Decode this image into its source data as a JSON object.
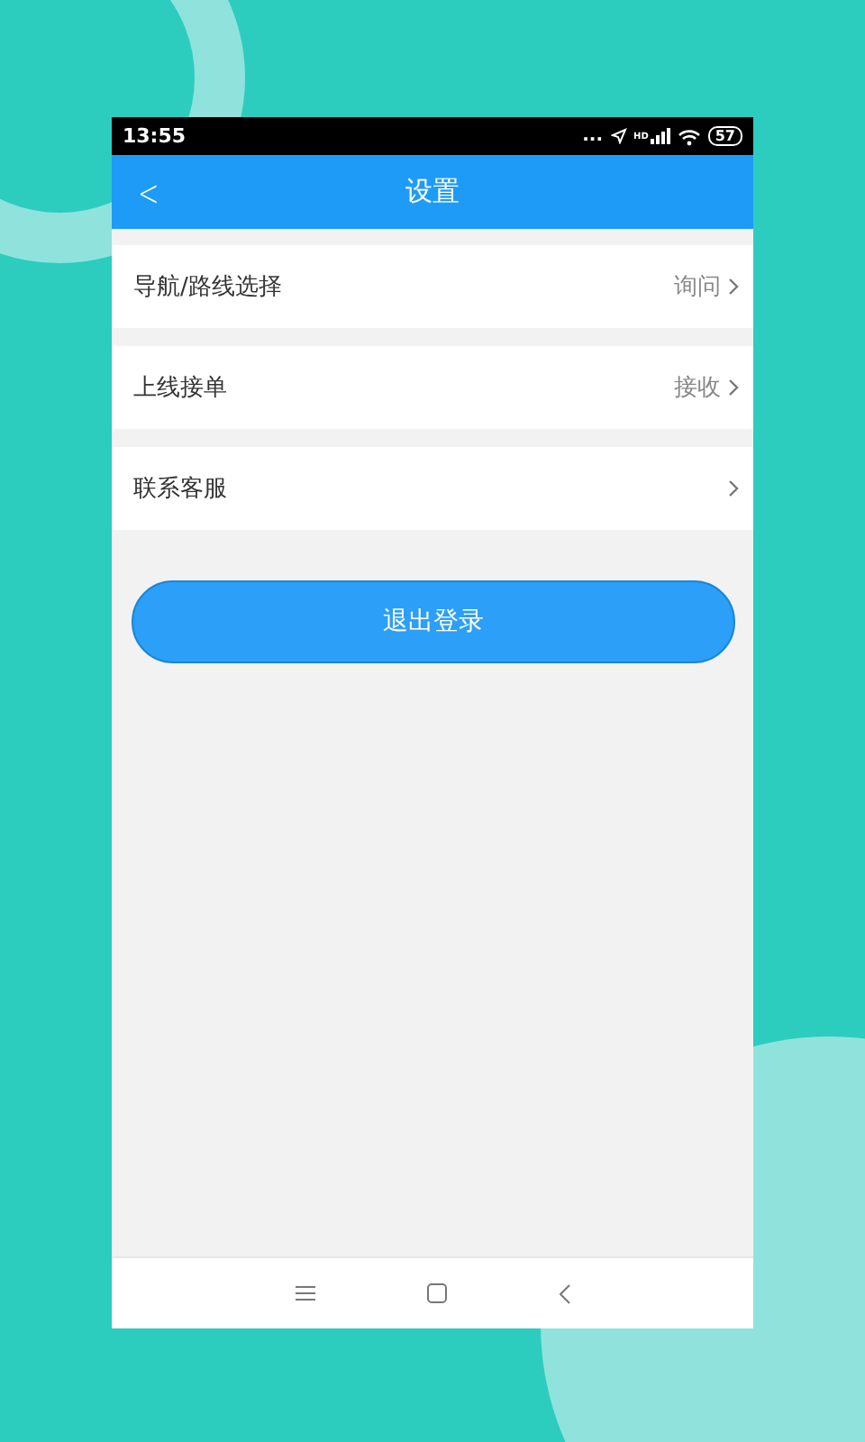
{
  "status_bar": {
    "time": "13:55",
    "dots": "...",
    "network": "HD",
    "battery": "57"
  },
  "header": {
    "back": "<",
    "title": "设置"
  },
  "settings": [
    {
      "label": "导航/路线选择",
      "value": "询问"
    },
    {
      "label": "上线接单",
      "value": "接收"
    },
    {
      "label": "联系客服"
    }
  ],
  "logout_button": "退出登录"
}
